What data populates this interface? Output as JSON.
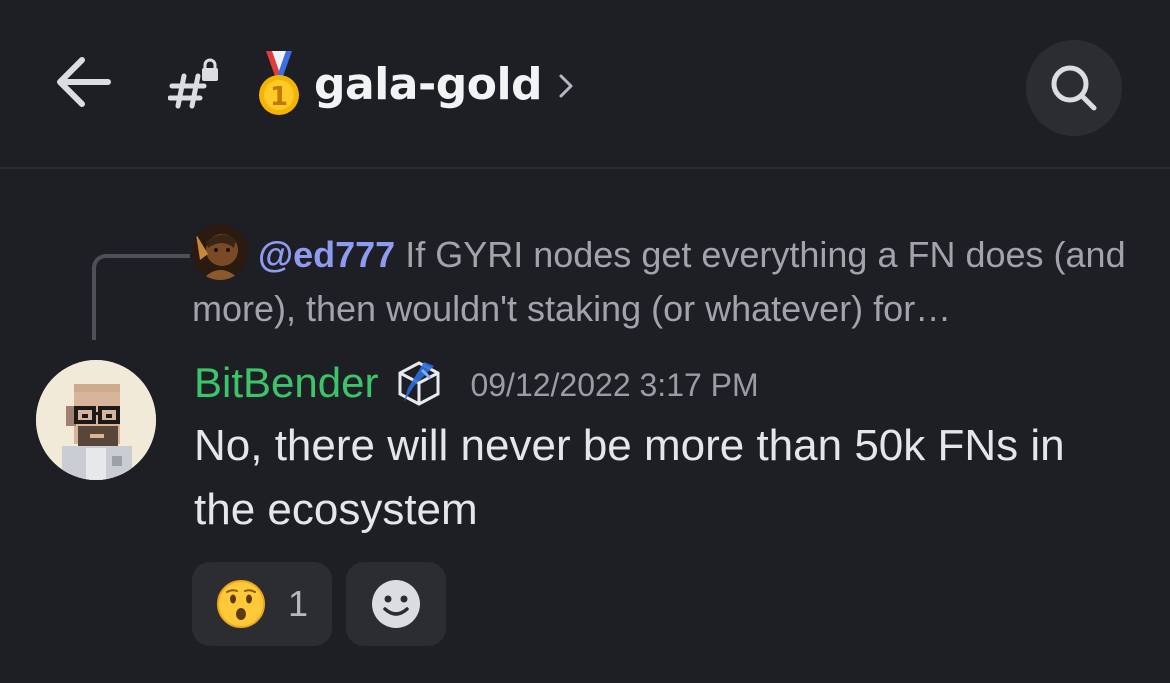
{
  "header": {
    "channel_name": "gala-gold",
    "back_icon": "arrow-left-icon",
    "channel_icon": "locked-hash-icon",
    "medal_icon": "first-place-medal-icon",
    "chevron_icon": "chevron-right-icon",
    "search_icon": "search-icon"
  },
  "reply": {
    "mention": "@ed777",
    "text": "If GYRI nodes get everything a FN does (and more), then wouldn't staking (or whatever) for…"
  },
  "message": {
    "username": "BitBender",
    "timestamp": "09/12/2022 3:17 PM",
    "text": "No, there will never be more than 50k FNs in the ecosystem"
  },
  "reactions": [
    {
      "emoji": "hushed-face",
      "count": "1"
    }
  ],
  "add_reaction_icon": "add-reaction-icon",
  "colors": {
    "background": "#1e1f24",
    "username": "#3bc56a",
    "mention": "#8f9bf0",
    "panel": "#2b2d31"
  }
}
